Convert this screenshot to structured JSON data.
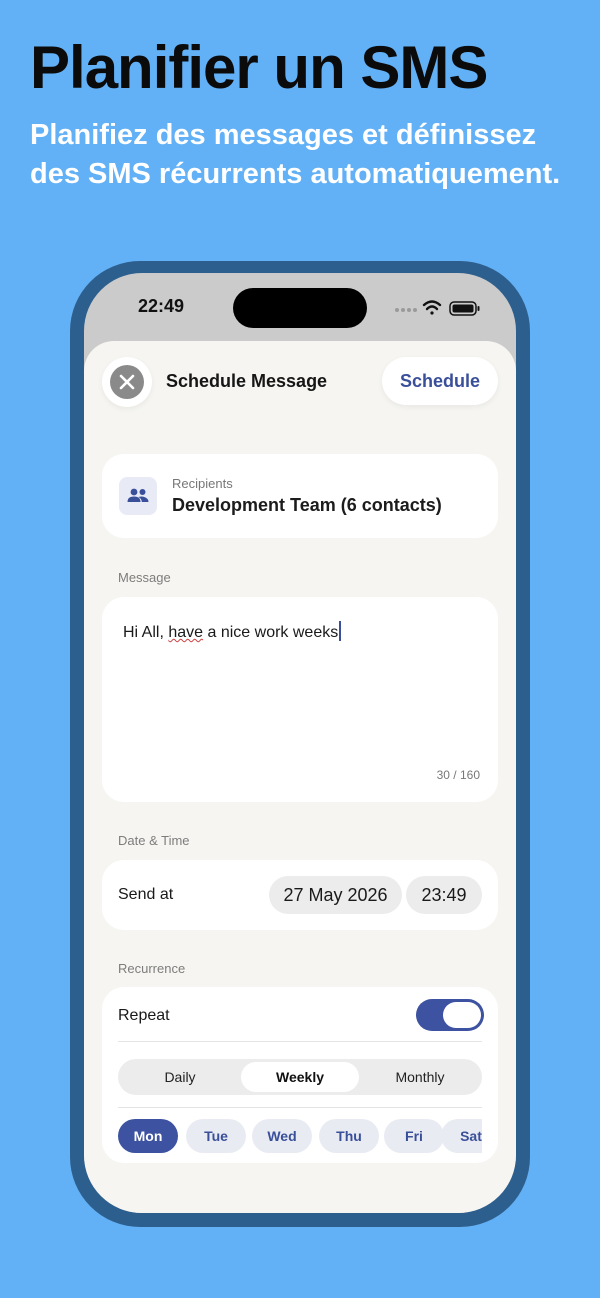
{
  "hero": {
    "title": "Planifier un SMS",
    "subtitle": "Planifiez des messages et définissez des SMS récurrents automatiquement."
  },
  "status_bar": {
    "time": "22:49",
    "icons": [
      "signal-dots-icon",
      "wifi-icon",
      "battery-icon"
    ]
  },
  "sheet": {
    "title": "Schedule Message",
    "close_icon": "close-icon",
    "schedule_label": "Schedule"
  },
  "recipients": {
    "label": "Recipients",
    "value": "Development Team (6 contacts)",
    "icon": "people-icon"
  },
  "message": {
    "section_label": "Message",
    "text_before": "Hi All, ",
    "text_misspelled": "have",
    "text_after": " a nice work weeks",
    "char_count": "30 / 160"
  },
  "datetime": {
    "section_label": "Date & Time",
    "send_label": "Send at",
    "date": "27 May 2026",
    "time": "23:49"
  },
  "recurrence": {
    "section_label": "Recurrence",
    "repeat_label": "Repeat",
    "repeat_on": true,
    "frequency": [
      "Daily",
      "Weekly",
      "Monthly"
    ],
    "selected_frequency": "Weekly",
    "days": [
      "Mon",
      "Tue",
      "Wed",
      "Thu",
      "Fri",
      "Sat"
    ],
    "selected_day": "Mon"
  },
  "colors": {
    "background": "#62b0f5",
    "phone_frame": "#2d5f8e",
    "accent": "#3d52a0"
  }
}
